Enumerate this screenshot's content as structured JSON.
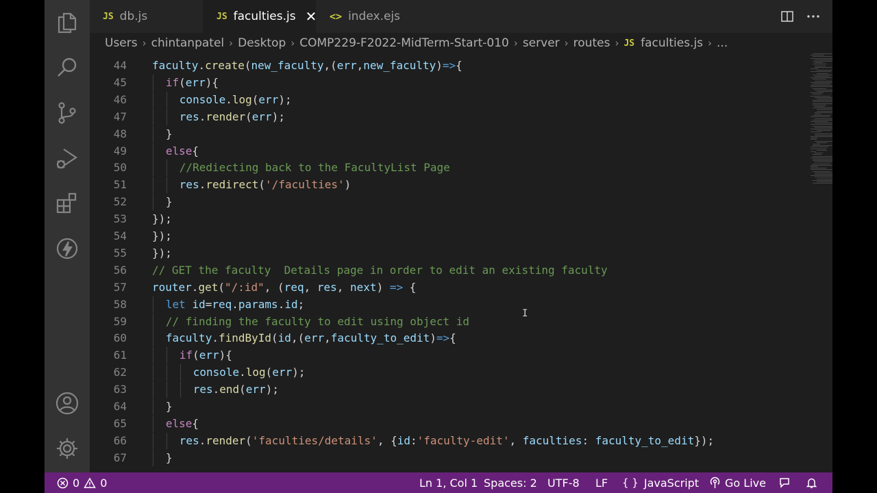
{
  "colors": {
    "statusbar": "#68217a",
    "activity_bar": "#333333",
    "editor_bg": "#1e1e1e",
    "tab_bar": "#252526"
  },
  "tabs": [
    {
      "icon": "JS",
      "label": "db.js",
      "active": false
    },
    {
      "icon": "JS",
      "label": "faculties.js",
      "active": true,
      "close": "✕"
    },
    {
      "icon": "<>",
      "label": "index.ejs",
      "active": false
    }
  ],
  "breadcrumb": {
    "items": [
      "Users",
      "chintanpatel",
      "Desktop",
      "COMP229-F2022-MidTerm-Start-010",
      "server",
      "routes",
      "faculties.js",
      "..."
    ],
    "file_icon": "JS"
  },
  "activity_icons": [
    "files-icon",
    "search-icon",
    "source-control-icon",
    "run-debug-icon",
    "extensions-icon",
    "lightning-icon",
    "account-icon",
    "gear-icon"
  ],
  "editor": {
    "lines": [
      {
        "n": "44",
        "text": "faculty.create(new_faculty,(err,new_faculty)=>{"
      },
      {
        "n": "45",
        "text": "if(err){"
      },
      {
        "n": "46",
        "text": "console.log(err);"
      },
      {
        "n": "47",
        "text": "res.render(err);"
      },
      {
        "n": "48",
        "text": "}"
      },
      {
        "n": "49",
        "text": "else{"
      },
      {
        "n": "50",
        "text": "//Rediecting back to the FacultyList Page"
      },
      {
        "n": "51",
        "text": "res.redirect('/faculties')"
      },
      {
        "n": "52",
        "text": "}"
      },
      {
        "n": "53",
        "text": "});"
      },
      {
        "n": "54",
        "text": "});"
      },
      {
        "n": "55",
        "text": "});"
      },
      {
        "n": "56",
        "text": "// GET the faculty  Details page in order to edit an existing faculty"
      },
      {
        "n": "57",
        "text": "router.get(\"/:id\", (req, res, next) => {"
      },
      {
        "n": "58",
        "text": "let id=req.params.id;"
      },
      {
        "n": "59",
        "text": "// finding the faculty to edit using object id"
      },
      {
        "n": "60",
        "text": "faculty.findById(id,(err,faculty_to_edit)=>{"
      },
      {
        "n": "61",
        "text": "if(err){"
      },
      {
        "n": "62",
        "text": "console.log(err);"
      },
      {
        "n": "63",
        "text": "res.end(err);"
      },
      {
        "n": "64",
        "text": "}"
      },
      {
        "n": "65",
        "text": "else{"
      },
      {
        "n": "66",
        "text": "res.render('faculties/details', {id:'faculty-edit', faculties: faculty_to_edit});"
      },
      {
        "n": "67",
        "text": "}"
      }
    ]
  },
  "status": {
    "errors": "0",
    "warnings": "0",
    "position": "Ln 1, Col 1",
    "spaces": "Spaces: 2",
    "encoding": "UTF-8",
    "eol": "LF",
    "language_icon": "{ }",
    "language": "JavaScript",
    "golive": "Go Live"
  }
}
